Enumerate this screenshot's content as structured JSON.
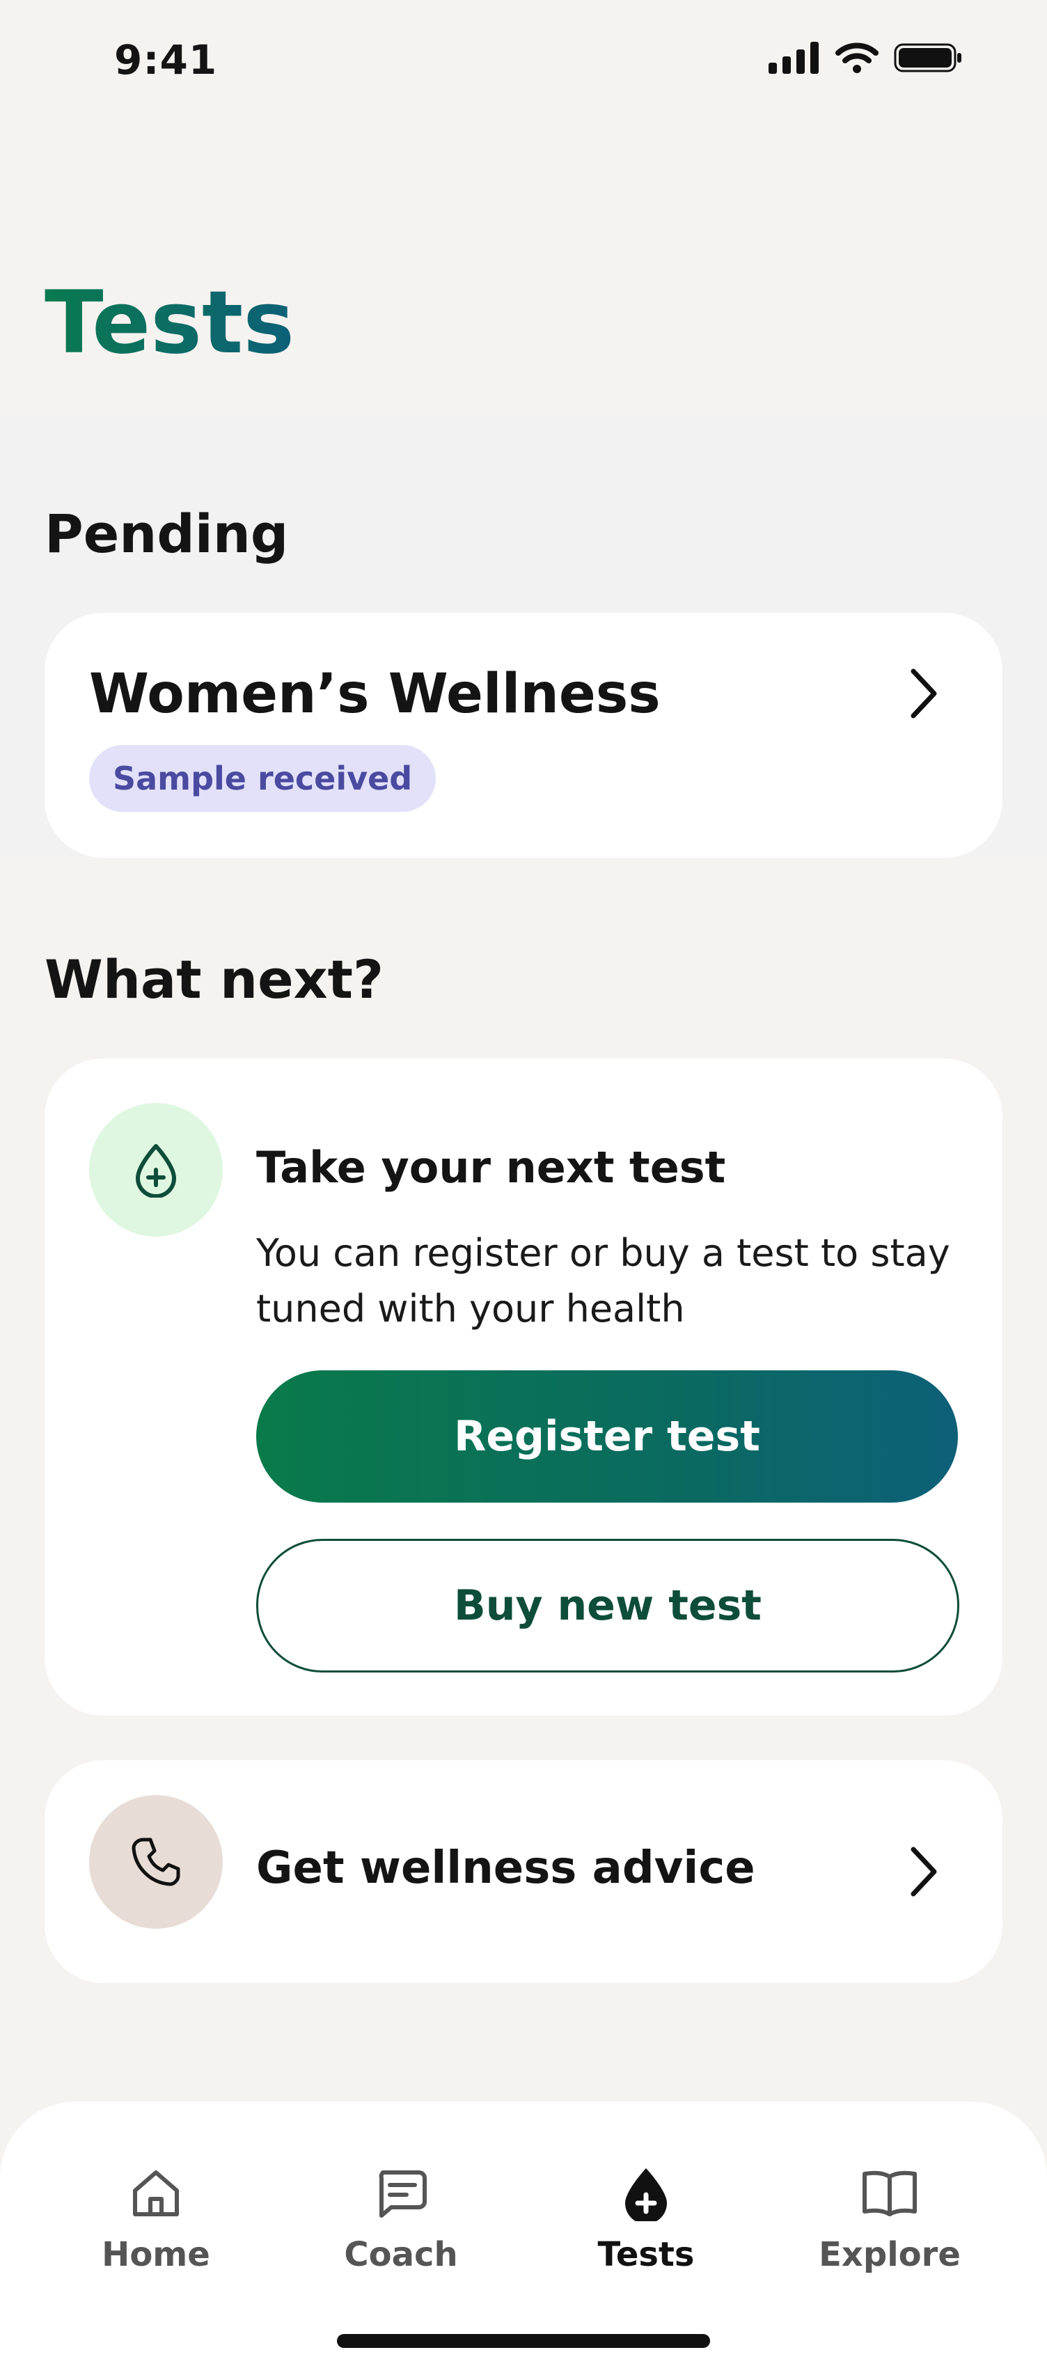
{
  "status_bar": {
    "time": "9:41"
  },
  "header": {
    "title": "Tests"
  },
  "pending": {
    "section_title": "Pending",
    "card": {
      "name": "Women’s Wellness",
      "status": "Sample received"
    }
  },
  "what_next": {
    "section_title": "What next?",
    "card": {
      "icon": "blood-drop-plus-icon",
      "title": "Take your next test",
      "description": "You can register or buy a test to stay tuned with your health",
      "primary_button": "Register test",
      "secondary_button": "Buy new test"
    }
  },
  "advice": {
    "icon": "phone-icon",
    "label": "Get wellness advice"
  },
  "tab_bar": {
    "items": [
      {
        "label": "Home",
        "icon": "home-icon"
      },
      {
        "label": "Coach",
        "icon": "chat-icon"
      },
      {
        "label": "Tests",
        "icon": "blood-drop-plus-icon",
        "active": true
      },
      {
        "label": "Explore",
        "icon": "book-icon"
      }
    ]
  },
  "colors": {
    "brand_green": "#0a7a4f",
    "brand_teal": "#0d6078",
    "badge_bg": "#e2e1f9",
    "badge_text": "#4a4aa0",
    "icon_green_bg": "#dff7e0",
    "icon_beige_bg": "#e8ddd6"
  }
}
